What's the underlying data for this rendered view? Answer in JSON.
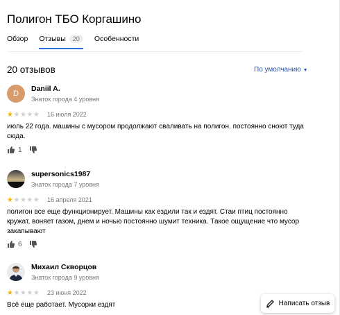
{
  "place": {
    "title": "Полигон ТБО Коргашино"
  },
  "tabs": [
    {
      "label": "Обзор"
    },
    {
      "label": "Отзывы",
      "count": "20"
    },
    {
      "label": "Особенности"
    }
  ],
  "reviews_header": {
    "count_text": "20 отзывов",
    "sort_label": "По умолчанию"
  },
  "reviews": [
    {
      "avatar_letter": "D",
      "author": "Daniil A.",
      "level": "Знаток города 4 уровня",
      "rating": 1,
      "date": "16 июля 2022",
      "text": "июль 22 года. машины с мусором продолжают сваливать на полигон. постоянно сноют туда сюда.",
      "likes": "1"
    },
    {
      "author": "supersonics1987",
      "level": "Знаток города 7 уровня",
      "rating": 1,
      "date": "16 апреля 2021",
      "text": "полигон все еще функционирует. Машины как ездили так и ездят. Стаи птиц постоянно кружат, воняет газом, днем и ночью постоянно шумит техника. Такое ощущение что мусор закапывают",
      "likes": "6"
    },
    {
      "author": "Михаил Скворцов",
      "level": "Знаток города 9 уровня",
      "rating": 1,
      "date": "23 июня 2022",
      "text": "Всё еще работает. Мусорки ездят"
    }
  ],
  "fab": {
    "label": "Написать отзыв"
  }
}
